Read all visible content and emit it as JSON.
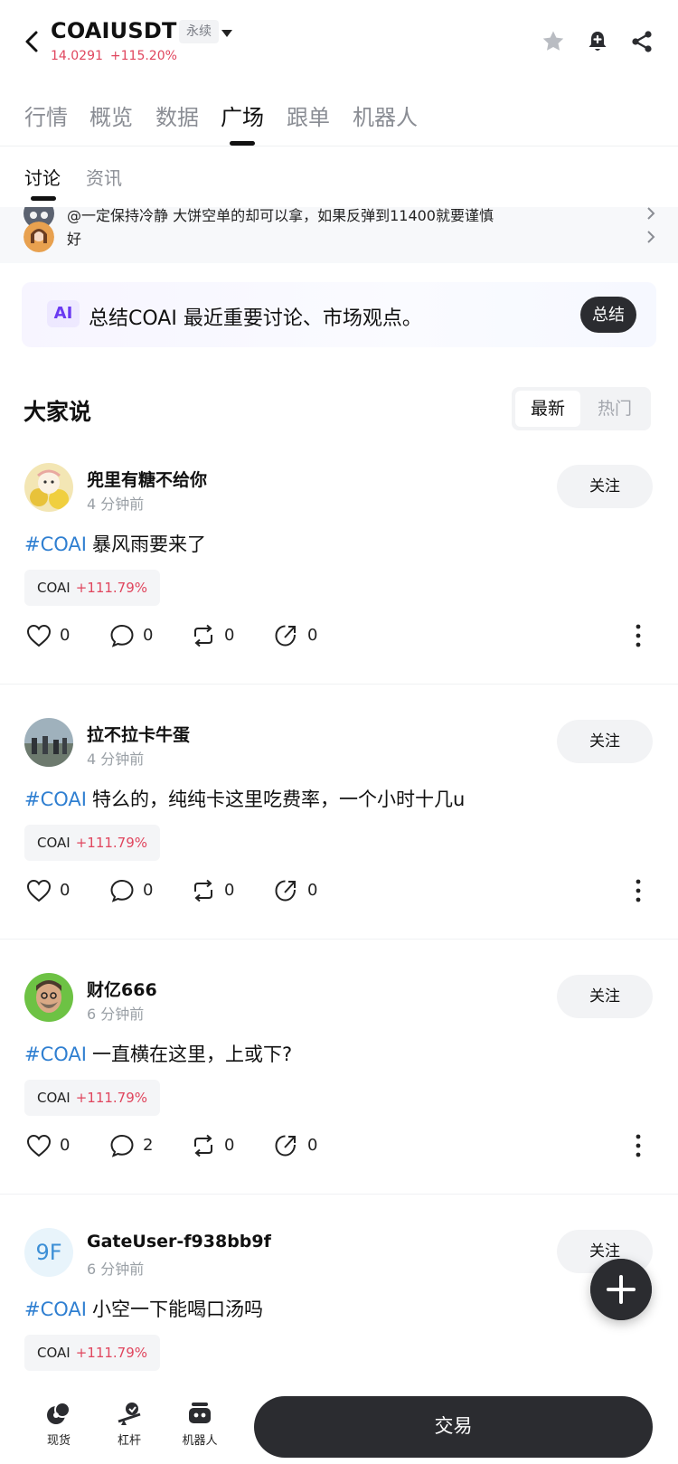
{
  "header": {
    "pair": "COAIUSDT",
    "badge": "永续",
    "price": "14.0291",
    "change": "+115.20%"
  },
  "main_tabs": [
    "行情",
    "概览",
    "数据",
    "广场",
    "跟单",
    "机器人"
  ],
  "active_main_tab": "广场",
  "sub_tabs": [
    "讨论",
    "资讯"
  ],
  "active_sub_tab": "讨论",
  "pinned": [
    {
      "text": "@一定保持冷静 大饼空单的却可以拿，如果反弹到11400就要谨慎"
    },
    {
      "text": "好"
    }
  ],
  "ai_summary": {
    "badge": "AI",
    "text": "总结COAI 最近重要讨论、市场观点。",
    "button": "总结"
  },
  "feed": {
    "title": "大家说",
    "sort_options": [
      "最新",
      "热门"
    ],
    "active_sort": "最新"
  },
  "posts": [
    {
      "user": "兜里有糖不给你",
      "time": "4 分钟前",
      "tag": "#COAI",
      "text": "暴风雨要来了",
      "coin": "COAI",
      "coin_change": "+111.79%",
      "likes": "0",
      "comments": "0",
      "reposts": "0",
      "shares": "0",
      "follow": "关注"
    },
    {
      "user": "拉不拉卡牛蛋",
      "time": "4 分钟前",
      "tag": "#COAI",
      "text": "特么的，纯纯卡这里吃费率，一个小时十几u",
      "coin": "COAI",
      "coin_change": "+111.79%",
      "likes": "0",
      "comments": "0",
      "reposts": "0",
      "shares": "0",
      "follow": "关注"
    },
    {
      "user": "财亿666",
      "time": "6 分钟前",
      "tag": "#COAI",
      "text": "一直横在这里，上或下?",
      "coin": "COAI",
      "coin_change": "+111.79%",
      "likes": "0",
      "comments": "2",
      "reposts": "0",
      "shares": "0",
      "follow": "关注"
    },
    {
      "user": "GateUser-f938bb9f",
      "avatar_text": "9F",
      "time": "6 分钟前",
      "tag": "#COAI",
      "text": "小空一下能喝口汤吗",
      "coin": "COAI",
      "coin_change": "+111.79%",
      "follow": "关注"
    }
  ],
  "bottom_nav": {
    "items": [
      "现货",
      "杠杆",
      "机器人"
    ],
    "trade": "交易"
  },
  "colors": {
    "up_red": "#e0465e",
    "hashtag_blue": "#2f7fd1",
    "dark": "#2b2c30"
  }
}
